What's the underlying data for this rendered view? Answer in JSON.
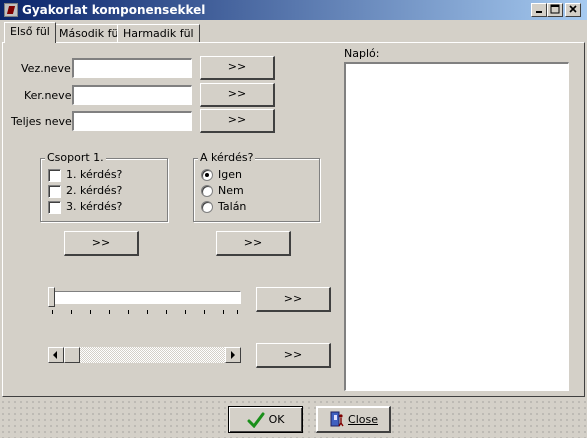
{
  "window": {
    "title": "Gyakorlat komponensekkel"
  },
  "tabs": [
    "Első fül",
    "Második fül",
    "Harmadik fül"
  ],
  "fields": [
    {
      "label": "Vez.neve:",
      "value": "",
      "button": ">>"
    },
    {
      "label": "Ker.neve:",
      "value": "",
      "button": ">>"
    },
    {
      "label": "Teljes neve:",
      "value": "",
      "button": ">>"
    }
  ],
  "group1": {
    "title": "Csoport 1.",
    "items": [
      {
        "label": "1. kérdés?",
        "checked": false
      },
      {
        "label": "2. kérdés?",
        "checked": false
      },
      {
        "label": "3. kérdés?",
        "checked": false
      }
    ],
    "button": ">>"
  },
  "group2": {
    "title": "A kérdés?",
    "items": [
      {
        "label": "Igen",
        "checked": true
      },
      {
        "label": "Nem",
        "checked": false
      },
      {
        "label": "Talán",
        "checked": false
      }
    ],
    "button": ">>"
  },
  "trackbar": {
    "position": 0,
    "button": ">>"
  },
  "scrollbar": {
    "position": 0,
    "button": ">>"
  },
  "log": {
    "label": "Napló:",
    "content": ""
  },
  "footer": {
    "ok_label": "OK",
    "close_label": "Close"
  },
  "colors": {
    "titlebar_start": "#0a246a",
    "titlebar_end": "#a6caf0",
    "ok_check": "#1a8f1a"
  },
  "icons": {
    "ok": "checkmark-icon",
    "close": "door-exit-icon",
    "app": "app-icon"
  }
}
